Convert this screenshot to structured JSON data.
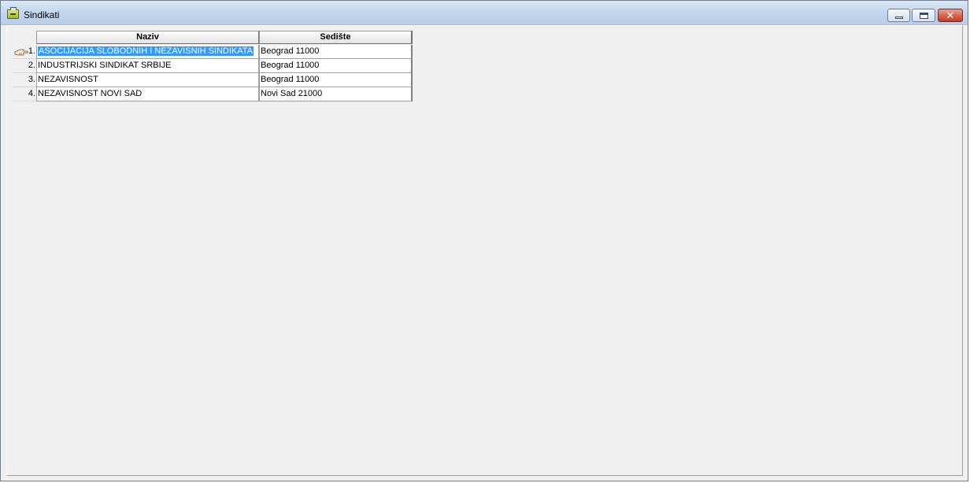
{
  "window": {
    "title": "Sindikati",
    "icon": "briefcase-icon",
    "controls": {
      "minimize": "minimize-icon",
      "maximize": "maximize-icon",
      "close": "close-icon",
      "close_glyph": "✕"
    }
  },
  "table": {
    "columns": [
      "Naziv",
      "Sedište"
    ],
    "rows": [
      {
        "num": "1.",
        "naziv": "ASOCIJACIJA SLOBODNIH I NEZAVISNIH SINDIKATA",
        "sediste": "Beograd  11000",
        "selected": true
      },
      {
        "num": "2.",
        "naziv": "INDUSTRIJSKI SINDIKAT SRBIJE",
        "sediste": "Beograd  11000"
      },
      {
        "num": "3.",
        "naziv": "NEZAVISNOST",
        "sediste": "Beograd  11000"
      },
      {
        "num": "4.",
        "naziv": "NEZAVISNOST NOVI SAD",
        "sediste": "Novi Sad  21000"
      }
    ]
  },
  "colors": {
    "selection": "#3399ff",
    "window_bg": "#f0f0f0"
  }
}
